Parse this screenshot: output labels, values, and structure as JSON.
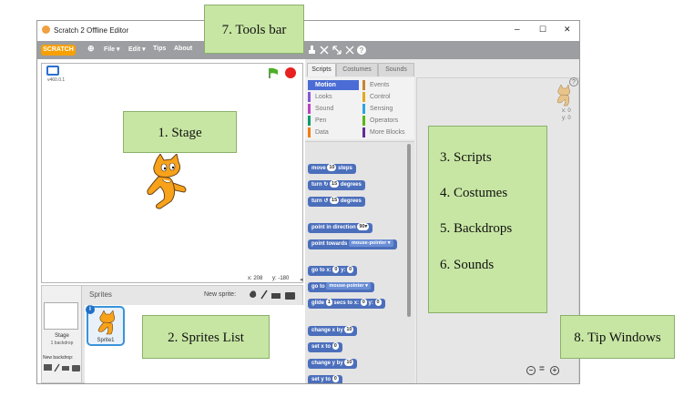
{
  "window": {
    "title": "Scratch 2 Offline Editor",
    "minimize_glyph": "–",
    "maximize_glyph": "☐",
    "close_glyph": "✕"
  },
  "menubar": {
    "logo": "SCRATCH",
    "globe_glyph": "⊕",
    "file": "File ▾",
    "edit": "Edit ▾",
    "tips": "Tips",
    "about": "About",
    "tool_icons": [
      "duplicate-stamp-icon",
      "cut-icon",
      "grow-icon",
      "shrink-icon",
      "help-icon"
    ]
  },
  "stage": {
    "version": "v460.0.1",
    "x_label": "x: 208",
    "y_label": "y: -180"
  },
  "sprites": {
    "header": "Sprites",
    "new_sprite_label": "New sprite:",
    "stage_thumb_label": "Stage",
    "stage_backdrops": "1 backdrop",
    "new_backdrop_label": "New backdrop:",
    "sprite1_label": "Sprite1"
  },
  "tabs": {
    "scripts": "Scripts",
    "costumes": "Costumes",
    "sounds": "Sounds"
  },
  "categories": [
    {
      "label": "Motion",
      "color": "#4a6cd4"
    },
    {
      "label": "Events",
      "color": "#c88330"
    },
    {
      "label": "Looks",
      "color": "#8a55d7"
    },
    {
      "label": "Control",
      "color": "#e1a91a"
    },
    {
      "label": "Sound",
      "color": "#bb42c3"
    },
    {
      "label": "Sensing",
      "color": "#2ca5e2"
    },
    {
      "label": "Pen",
      "color": "#0e9a6c"
    },
    {
      "label": "Operators",
      "color": "#5cb712"
    },
    {
      "label": "Data",
      "color": "#ee7d16"
    },
    {
      "label": "More Blocks",
      "color": "#632d99"
    }
  ],
  "blocks": {
    "move_a": "move",
    "move_val": "10",
    "move_b": "steps",
    "turn_cw_a": "turn ↻",
    "turn_cw_val": "15",
    "turn_cw_b": "degrees",
    "turn_ccw_a": "turn ↺",
    "turn_ccw_val": "15",
    "turn_ccw_b": "degrees",
    "point_dir_a": "point in direction",
    "point_dir_val": "90▾",
    "point_towards_a": "point towards",
    "point_towards_val": "mouse-pointer ▾",
    "goto_xy_a": "go to x:",
    "goto_xy_x": "0",
    "goto_xy_mid": "y:",
    "goto_xy_y": "0",
    "goto_a": "go to",
    "goto_val": "mouse-pointer ▾",
    "glide_a": "glide",
    "glide_secs": "1",
    "glide_b": "secs to x:",
    "glide_x": "0",
    "glide_mid": "y:",
    "glide_y": "0",
    "change_x_a": "change x by",
    "change_x_val": "10",
    "set_x_a": "set x to",
    "set_x_val": "0",
    "change_y_a": "change y by",
    "change_y_val": "10",
    "set_y_a": "set y to",
    "set_y_val": "0"
  },
  "script_sprite": {
    "x_label": "x: 0",
    "y_label": "y: 0"
  },
  "zoom": {
    "out": "−",
    "reset": "=",
    "in": "+"
  },
  "callouts": {
    "tools_bar": "7. Tools bar",
    "stage": "1. Stage",
    "scripts": "3. Scripts",
    "costumes": "4. Costumes",
    "backdrops": "5. Backdrops",
    "sounds": "6. Sounds",
    "sprites_list": "2. Sprites List",
    "tip_windows": "8. Tip Windows"
  },
  "colors": {
    "callout_fill": "#c7e6a3",
    "menubar": "#9c9ea1",
    "motion_block": "#4c6fbc"
  }
}
